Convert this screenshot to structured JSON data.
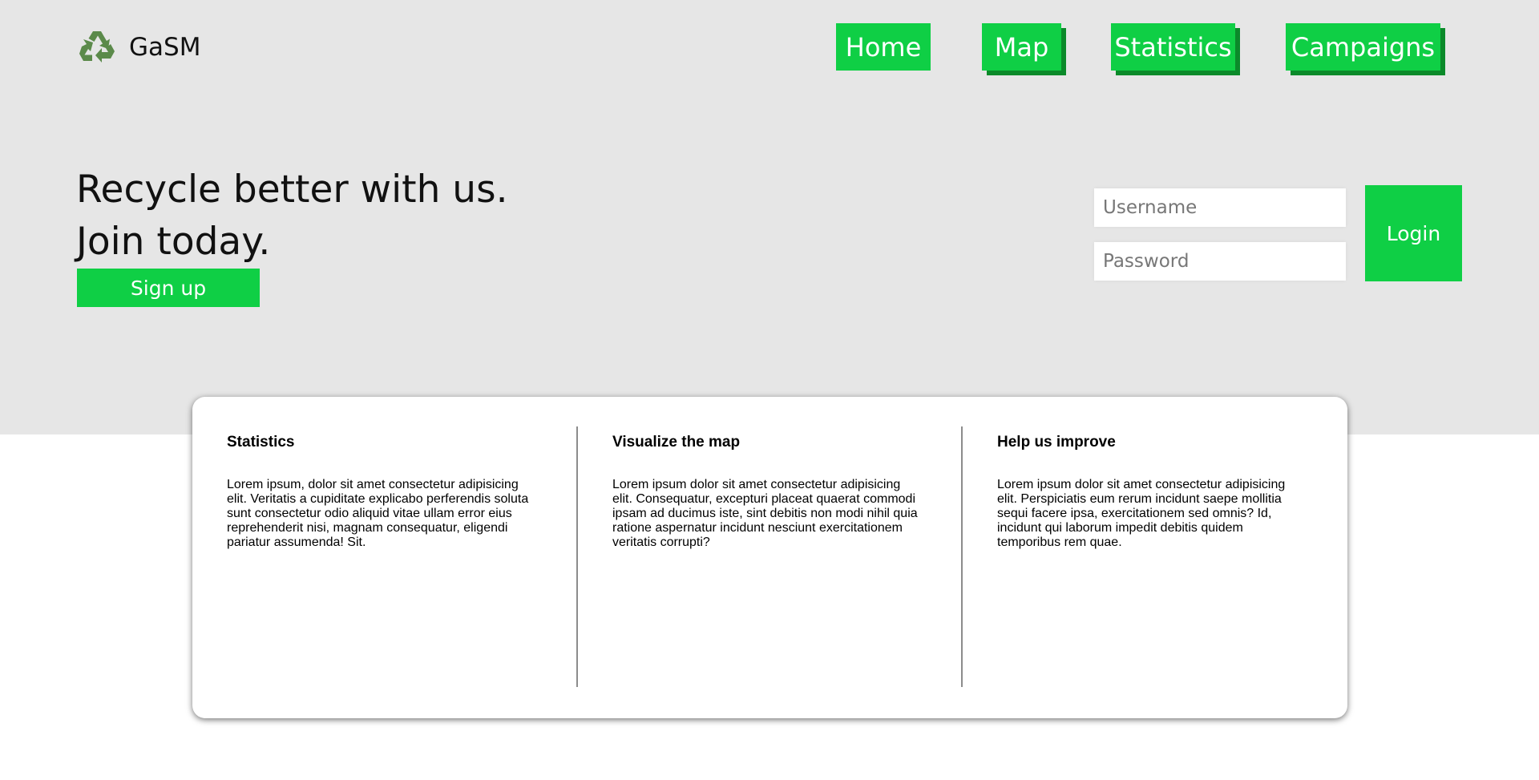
{
  "brand": {
    "name": "GaSM",
    "icon": "recycle-icon",
    "icon_color": "#5b8a4a"
  },
  "nav": [
    {
      "label": "Home"
    },
    {
      "label": "Map"
    },
    {
      "label": "Statistics"
    },
    {
      "label": "Campaigns"
    }
  ],
  "hero": {
    "line1": "Recycle better with us.",
    "line2": "Join today.",
    "signup_label": "Sign up"
  },
  "login": {
    "username_placeholder": "Username",
    "password_placeholder": "Password",
    "button_label": "Login"
  },
  "features": [
    {
      "title": "Statistics",
      "text": "Lorem ipsum, dolor sit amet consectetur adipisicing elit. Veritatis a cupiditate explicabo perferendis soluta sunt consectetur odio aliquid vitae ullam error eius reprehenderit nisi, magnam consequatur, eligendi pariatur assumenda! Sit."
    },
    {
      "title": "Visualize the map",
      "text": "Lorem ipsum dolor sit amet consectetur adipisicing elit. Consequatur, excepturi placeat quaerat commodi ipsam ad ducimus iste, sint debitis non modi nihil quia ratione aspernatur incidunt nesciunt exercitationem veritatis corrupti?"
    },
    {
      "title": "Help us improve",
      "text": "Lorem ipsum dolor sit amet consectetur adipisicing elit. Perspiciatis eum rerum incidunt saepe mollitia sequi facere ipsa, exercitationem sed omnis? Id, incidunt qui laborum impedit debitis quidem temporibus rem quae."
    }
  ],
  "colors": {
    "accent": "#0fcf45",
    "accent_shadow": "#0b8a2a",
    "hero_background": "#e6e6e6"
  }
}
